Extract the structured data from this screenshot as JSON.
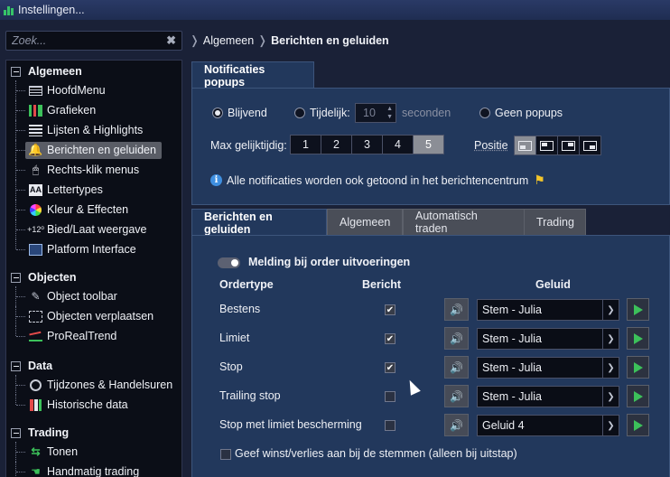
{
  "window": {
    "title": "Instellingen..."
  },
  "search": {
    "placeholder": "Zoek..."
  },
  "sidebar": {
    "groups": [
      {
        "label": "Algemeen",
        "items": [
          {
            "label": "HoofdMenu",
            "icon": "menu-icon"
          },
          {
            "label": "Grafieken",
            "icon": "chart-icon"
          },
          {
            "label": "Lijsten & Highlights",
            "icon": "list-icon"
          },
          {
            "label": "Berichten en geluiden",
            "icon": "bell-icon",
            "selected": true
          },
          {
            "label": "Rechts-klik menus",
            "icon": "mouse-icon"
          },
          {
            "label": "Lettertypes",
            "icon": "font-icon"
          },
          {
            "label": "Kleur & Effecten",
            "icon": "color-wheel-icon"
          },
          {
            "label": "Bied/Laat weergave",
            "icon": "bid-ask-icon",
            "icon_text": "+12⁰"
          },
          {
            "label": "Platform Interface",
            "icon": "platform-icon"
          }
        ]
      },
      {
        "label": "Objecten",
        "items": [
          {
            "label": "Object toolbar",
            "icon": "toolbar-icon"
          },
          {
            "label": "Objecten verplaatsen",
            "icon": "move-icon"
          },
          {
            "label": "ProRealTrend",
            "icon": "trend-icon"
          }
        ]
      },
      {
        "label": "Data",
        "items": [
          {
            "label": "Tijdzones & Handelsuren",
            "icon": "clock-icon"
          },
          {
            "label": "Historische data",
            "icon": "history-icon"
          }
        ]
      },
      {
        "label": "Trading",
        "items": [
          {
            "label": "Tonen",
            "icon": "arrow-icon"
          },
          {
            "label": "Handmatig trading",
            "icon": "hand-icon"
          }
        ]
      }
    ]
  },
  "breadcrumb": {
    "parent": "Algemeen",
    "current": "Berichten en geluiden"
  },
  "popups": {
    "tab_label": "Notificaties popups",
    "mode_options": [
      "Blijvend",
      "Tijdelijk:",
      "Geen popups"
    ],
    "selected_mode": "Blijvend",
    "seconds_value": "10",
    "seconds_unit": "seconden",
    "max_label": "Max gelijktijdig:",
    "max_options": [
      "1",
      "2",
      "3",
      "4",
      "5"
    ],
    "max_selected": "5",
    "position_label": "Positie",
    "position_selected_index": 0,
    "info_text": "Alle notificaties worden ook getoond in het berichtencentrum"
  },
  "messages": {
    "tabs": [
      "Berichten en geluiden",
      "Algemeen",
      "Automatisch traden",
      "Trading"
    ],
    "active_tab": "Berichten en geluiden",
    "toggle_label": "Melding bij order uitvoeringen",
    "col_ordertype": "Ordertype",
    "col_bericht": "Bericht",
    "col_geluid": "Geluid",
    "rows": [
      {
        "type": "Bestens",
        "bericht": true,
        "sound": "Stem - Julia"
      },
      {
        "type": "Limiet",
        "bericht": true,
        "sound": "Stem - Julia"
      },
      {
        "type": "Stop",
        "bericht": true,
        "sound": "Stem - Julia"
      },
      {
        "type": "Trailing stop",
        "bericht": false,
        "sound": "Stem - Julia"
      },
      {
        "type": "Stop met limiet bescherming",
        "bericht": false,
        "sound": "Geluid 4"
      }
    ],
    "footer_checkbox_label": "Geef winst/verlies aan bij de stemmen (alleen bij uitstap)",
    "footer_checked": false
  },
  "colors": {
    "accent": "#22385c",
    "bg": "#1a2137",
    "play": "#3cc15a",
    "flag": "#f3c52a"
  }
}
